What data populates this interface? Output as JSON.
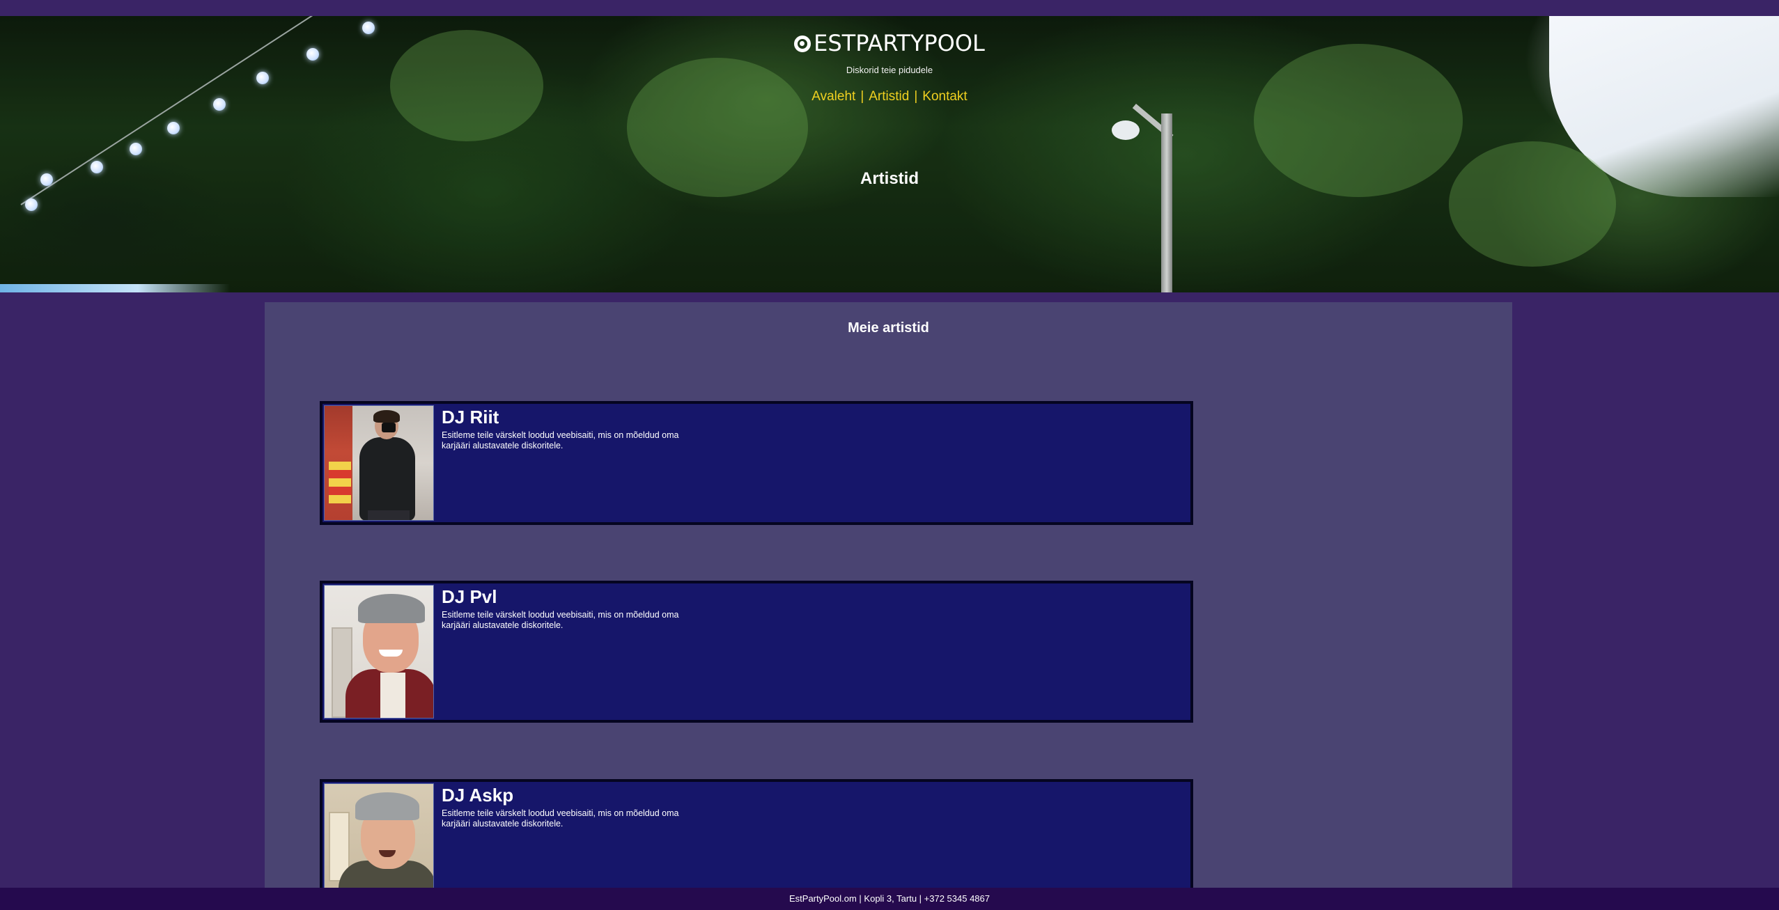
{
  "header": {
    "brand": "ESTPARTYPOOL",
    "tagline": "Diskorid teie pidudele",
    "nav": [
      {
        "label": "Avaleht"
      },
      {
        "label": "Artistid"
      },
      {
        "label": "Kontakt"
      }
    ],
    "separator": "|",
    "hero_title": "Artistid"
  },
  "main": {
    "section_title": "Meie artistid",
    "artists": [
      {
        "name": "DJ Riit",
        "description": "Esitleme teile värskelt loodud veebisaiti, mis on mõeldud oma karjääri alustavatele diskoritele."
      },
      {
        "name": "DJ Pvl",
        "description": "Esitleme teile värskelt loodud veebisaiti, mis on mõeldud oma karjääri alustavatele diskoritele."
      },
      {
        "name": "DJ Askp",
        "description": "Esitleme teile värskelt loodud veebisaiti, mis on mõeldud oma karjääri alustavatele diskoritele."
      }
    ]
  },
  "footer": {
    "text": "EstPartyPool.om | Kopli 3, Tartu | +372 5345 4867"
  },
  "colors": {
    "page_bg": "#3a2466",
    "content_bg": "#4a4472",
    "card_bg": "#16166a",
    "nav_link": "#f0d020",
    "footer_bg": "#250a4e"
  }
}
